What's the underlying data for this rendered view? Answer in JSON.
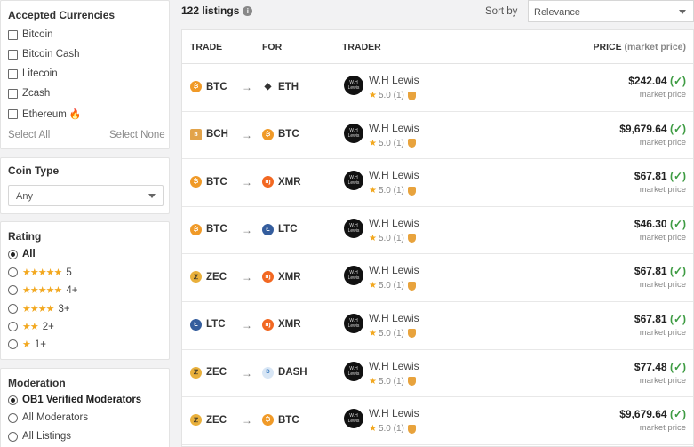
{
  "currencies": {
    "title": "Accepted Currencies",
    "items": [
      {
        "label": "Bitcoin",
        "checked": false
      },
      {
        "label": "Bitcoin Cash",
        "checked": false
      },
      {
        "label": "Litecoin",
        "checked": false
      },
      {
        "label": "Zcash",
        "checked": false
      },
      {
        "label": "Ethereum",
        "checked": false,
        "icon": "fire-icon"
      }
    ],
    "select_all": "Select All",
    "select_none": "Select None"
  },
  "coin_type": {
    "title": "Coin Type",
    "value": "Any"
  },
  "rating": {
    "title": "Rating",
    "options": [
      {
        "label": "All",
        "stars": "",
        "selected": true
      },
      {
        "label": "5",
        "stars": "★★★★★",
        "selected": false
      },
      {
        "label": "4+",
        "stars": "★★★★★",
        "selected": false
      },
      {
        "label": "3+",
        "stars": "★★★★",
        "selected": false
      },
      {
        "label": "2+",
        "stars": "★★",
        "selected": false
      },
      {
        "label": "1+",
        "stars": "★",
        "selected": false
      }
    ]
  },
  "moderation": {
    "title": "Moderation",
    "options": [
      {
        "label": "OB1 Verified Moderators",
        "selected": true
      },
      {
        "label": "All Moderators",
        "selected": false
      },
      {
        "label": "All Listings",
        "selected": false
      }
    ]
  },
  "topbar": {
    "count": "122 listings",
    "info_icon": "i",
    "sort_label": "Sort by",
    "sort_value": "Relevance"
  },
  "table": {
    "headers": {
      "trade": "TRADE",
      "for": "FOR",
      "trader": "TRADER",
      "price": "PRICE",
      "price_note": "(market price)"
    },
    "rows": [
      {
        "trade": "BTC",
        "trade_icon": "btc",
        "for": "ETH",
        "for_icon": "eth",
        "trader": "W.H Lewis",
        "rating": "5.0 (1)",
        "price": "$242.04",
        "note": "market price"
      },
      {
        "trade": "BCH",
        "trade_icon": "bch",
        "for": "BTC",
        "for_icon": "btc",
        "trader": "W.H Lewis",
        "rating": "5.0 (1)",
        "price": "$9,679.64",
        "note": "market price"
      },
      {
        "trade": "BTC",
        "trade_icon": "btc",
        "for": "XMR",
        "for_icon": "xmr",
        "trader": "W.H Lewis",
        "rating": "5.0 (1)",
        "price": "$67.81",
        "note": "market price"
      },
      {
        "trade": "BTC",
        "trade_icon": "btc",
        "for": "LTC",
        "for_icon": "ltc",
        "trader": "W.H Lewis",
        "rating": "5.0 (1)",
        "price": "$46.30",
        "note": "market price"
      },
      {
        "trade": "ZEC",
        "trade_icon": "zec",
        "for": "XMR",
        "for_icon": "xmr",
        "trader": "W.H Lewis",
        "rating": "5.0 (1)",
        "price": "$67.81",
        "note": "market price"
      },
      {
        "trade": "LTC",
        "trade_icon": "ltc",
        "for": "XMR",
        "for_icon": "xmr",
        "trader": "W.H Lewis",
        "rating": "5.0 (1)",
        "price": "$67.81",
        "note": "market price"
      },
      {
        "trade": "ZEC",
        "trade_icon": "zec",
        "for": "DASH",
        "for_icon": "dash",
        "trader": "W.H Lewis",
        "rating": "5.0 (1)",
        "price": "$77.48",
        "note": "market price"
      },
      {
        "trade": "ZEC",
        "trade_icon": "zec",
        "for": "BTC",
        "for_icon": "btc",
        "trader": "W.H Lewis",
        "rating": "5.0 (1)",
        "price": "$9,679.64",
        "note": "market price"
      }
    ]
  },
  "colors": {
    "accent_check": "#3d9b42",
    "star": "#f2a820",
    "btc": "#f09a28"
  }
}
